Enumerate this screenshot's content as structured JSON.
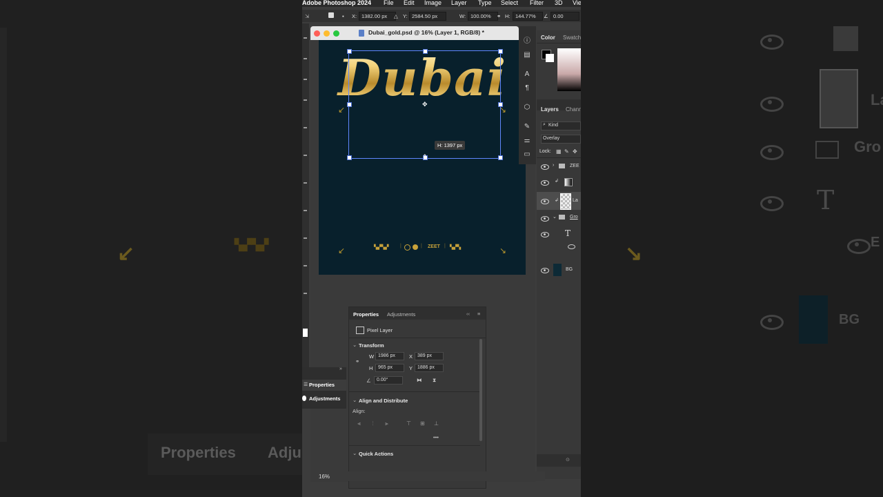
{
  "menubar": {
    "app_name": "Adobe Photoshop 2024",
    "items": [
      "File",
      "Edit",
      "Image",
      "Layer",
      "Type",
      "Select",
      "Filter",
      "3D",
      "Vie"
    ]
  },
  "options": {
    "x_label": "X:",
    "x_value": "1382.00 px",
    "y_label": "Y:",
    "y_value": "2584.50 px",
    "w_label": "W:",
    "w_value": "100.00%",
    "h_label": "H:",
    "h_value": "144.77%",
    "angle_value": "0.00"
  },
  "document": {
    "title": "Dubai_gold.psd @ 16% (Layer 1, RGB/8) *",
    "headline": "Dubai",
    "height_badge": "H: 1397 px",
    "footer_brand": "ZEET",
    "zoom": "16%"
  },
  "side_panels": {
    "color_tab": "Color",
    "swatches_tab": "Swatch",
    "layers_tab": "Layers",
    "channels_tab": "Chann",
    "kind_filter": "Kind",
    "blend_mode": "Overlay",
    "lock_label": "Lock:",
    "layers": [
      {
        "name": "ZEE"
      },
      {
        "name": ""
      },
      {
        "name": "La"
      },
      {
        "name": "Gro"
      },
      {
        "name": ""
      },
      {
        "name": "BG"
      }
    ]
  },
  "mini_panel": {
    "properties": "Properties",
    "adjustments": "Adjustments"
  },
  "properties": {
    "tab_properties": "Properties",
    "tab_adjustments": "Adjustments",
    "layer_type": "Pixel Layer",
    "transform_header": "Transform",
    "w_label": "W",
    "w_value": "1986 px",
    "x_label": "X",
    "x_value": "389 px",
    "h_label": "H",
    "h_value": "965 px",
    "y_label": "Y",
    "y_value": "1886 px",
    "angle": "0.00°",
    "align_header": "Align and Distribute",
    "align_label": "Align:",
    "more": "•••",
    "quick_actions": "Quick Actions"
  },
  "ghost_background": {
    "properties": "Properties",
    "adjustments": "Adju",
    "t_glyph": "T",
    "gro": "Gro",
    "la": "La",
    "bg": "BG",
    "e": "E"
  },
  "colors": {
    "canvas_bg": "#08202c",
    "gold": "#d4af37",
    "selection": "#5f87ff"
  }
}
